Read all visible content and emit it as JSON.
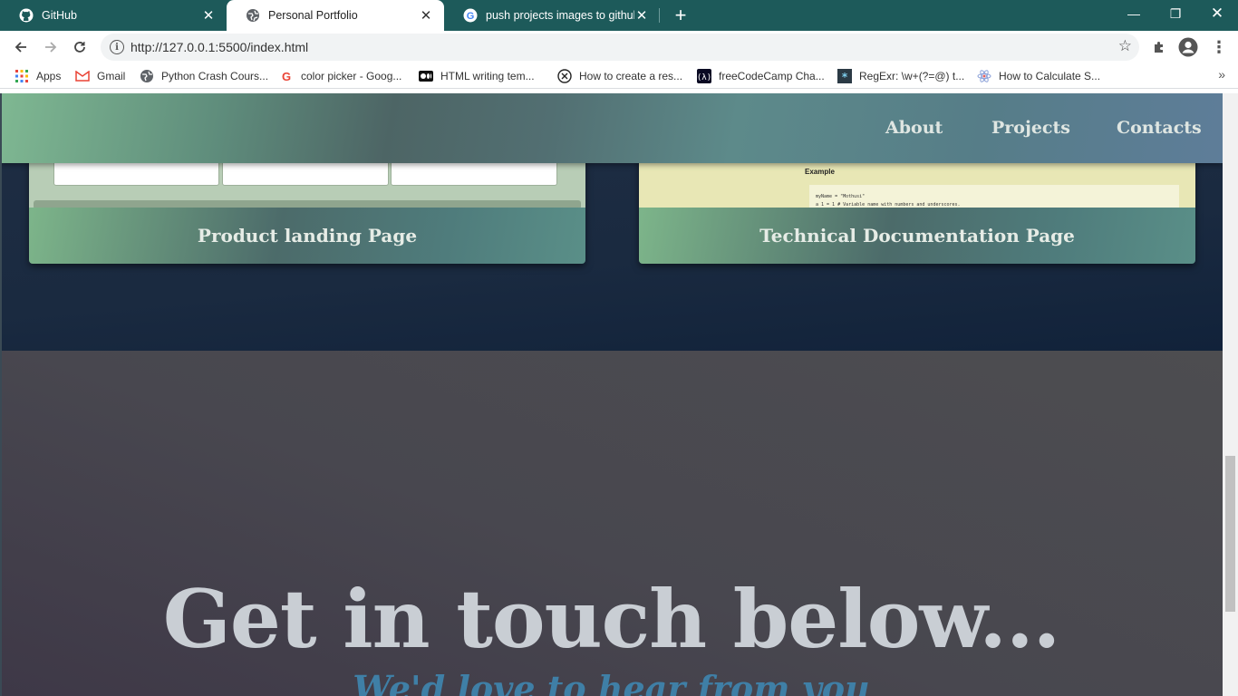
{
  "browser": {
    "tabs": [
      {
        "title": "GitHub",
        "icon": "github-icon",
        "active": false
      },
      {
        "title": "Personal Portfolio",
        "icon": "globe-icon",
        "active": true
      },
      {
        "title": "push projects images to github -",
        "icon": "google-icon",
        "active": false
      }
    ],
    "url": "http://127.0.0.1:5500/index.html",
    "bookmarks": [
      {
        "label": "Apps",
        "icon": "apps-grid-icon"
      },
      {
        "label": "Gmail",
        "icon": "gmail-icon"
      },
      {
        "label": "Python Crash Cours...",
        "icon": "globe-icon"
      },
      {
        "label": "color picker - Goog...",
        "icon": "google-icon"
      },
      {
        "label": "HTML  writing tem...",
        "icon": "medium-icon"
      },
      {
        "label": "How to create a res...",
        "icon": "x-circle-icon"
      },
      {
        "label": "freeCodeCamp Cha...",
        "icon": "freecodecamp-icon"
      },
      {
        "label": "RegExr: \\w+(?=@) t...",
        "icon": "regexr-icon"
      },
      {
        "label": "How to Calculate S...",
        "icon": "atom-icon"
      }
    ],
    "colors": {
      "tabbar": "#1d5a5a",
      "accent": "#3f7fa6"
    }
  },
  "nav": {
    "links": [
      "About",
      "Projects",
      "Contacts"
    ]
  },
  "projects": {
    "cards": [
      {
        "title": "Product landing Page"
      },
      {
        "title": "Technical Documentation Page"
      }
    ],
    "doc_preview": {
      "heading": "Example",
      "code": [
        "myName = \"Mothusi\"",
        "a 1 = 1 # Variable name with numbers and underscores."
      ]
    }
  },
  "contact": {
    "headline": "Get in touch below...",
    "subline": "We'd love to hear from you"
  }
}
